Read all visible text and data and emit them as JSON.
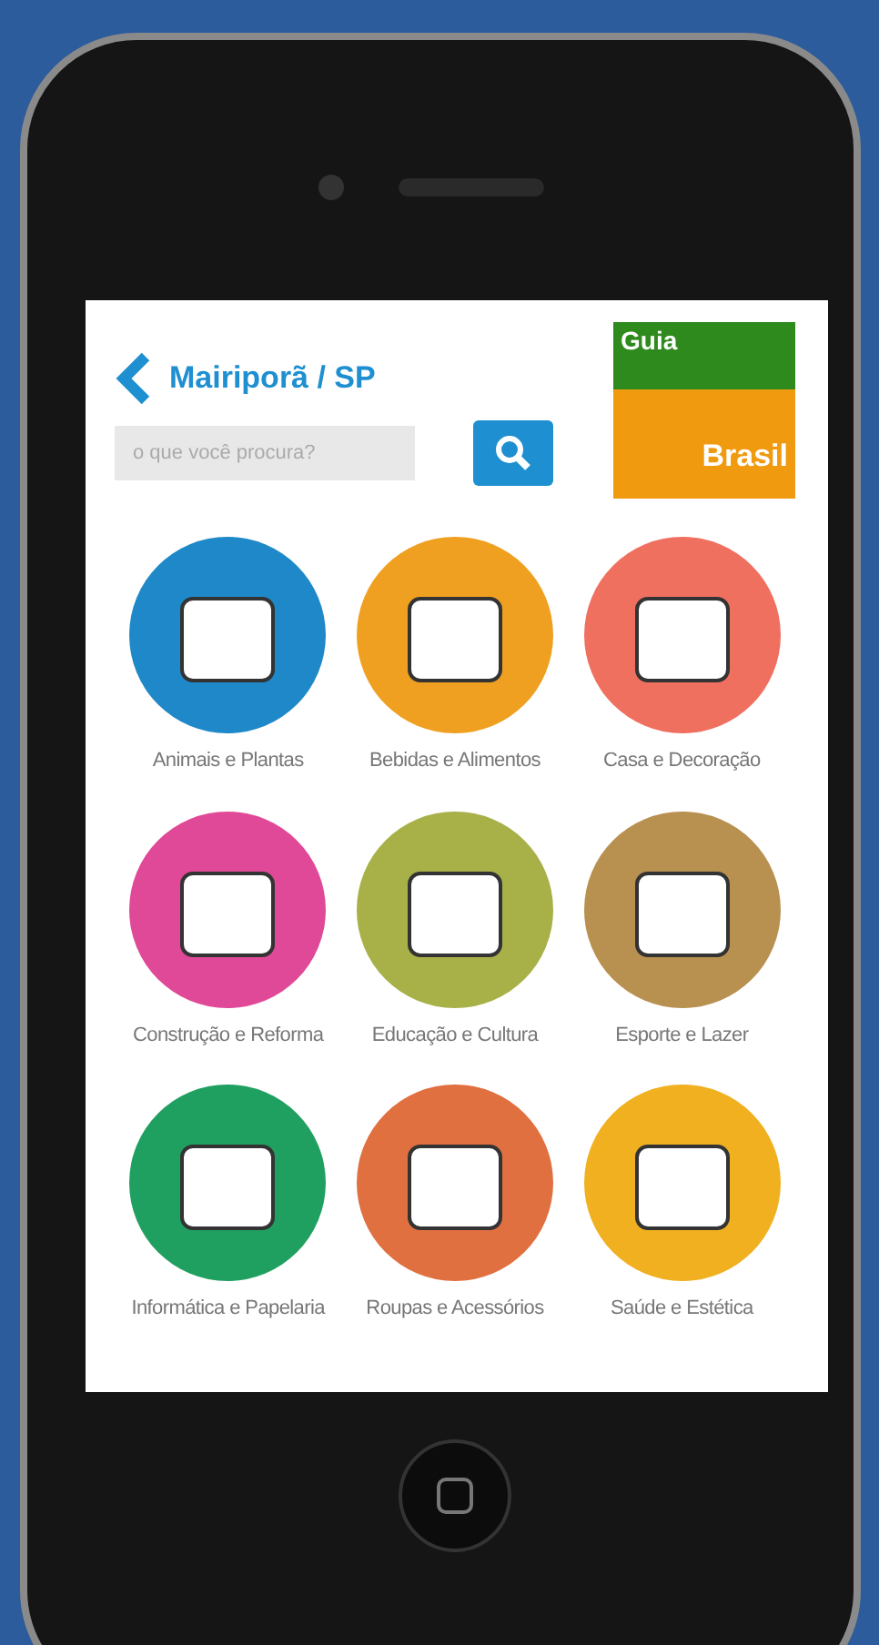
{
  "header": {
    "title": "Mairiporã / SP"
  },
  "search": {
    "placeholder": "o que você procura?"
  },
  "logo": {
    "top": "Guia",
    "bottom": "Brasil"
  },
  "categories": [
    {
      "label": "Animais e Plantas",
      "color": "#1e88c8"
    },
    {
      "label": "Bebidas e Alimentos",
      "color": "#f0a020"
    },
    {
      "label": "Casa e Decoração",
      "color": "#f07060"
    },
    {
      "label": "Construção e Reforma",
      "color": "#e04898"
    },
    {
      "label": "Educação e Cultura",
      "color": "#a8b048"
    },
    {
      "label": "Esporte e Lazer",
      "color": "#b89050"
    },
    {
      "label": "Informática e Papelaria",
      "color": "#20a060"
    },
    {
      "label": "Roupas e Acessórios",
      "color": "#e07040"
    },
    {
      "label": "Saúde e Estética",
      "color": "#f0b020"
    }
  ]
}
